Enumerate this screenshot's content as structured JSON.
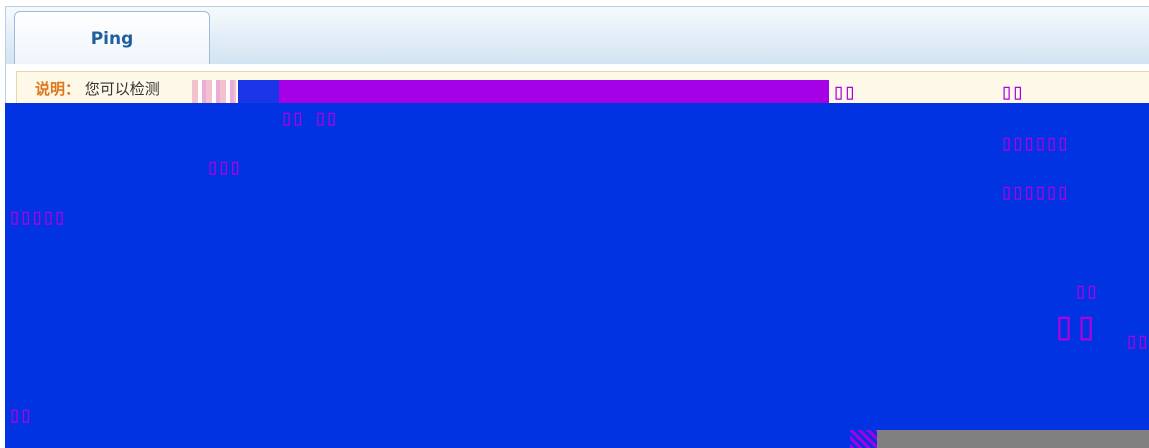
{
  "tabs": [
    {
      "label": "Ping"
    }
  ],
  "notice": {
    "label": "说明：",
    "text": "您可以检测"
  }
}
